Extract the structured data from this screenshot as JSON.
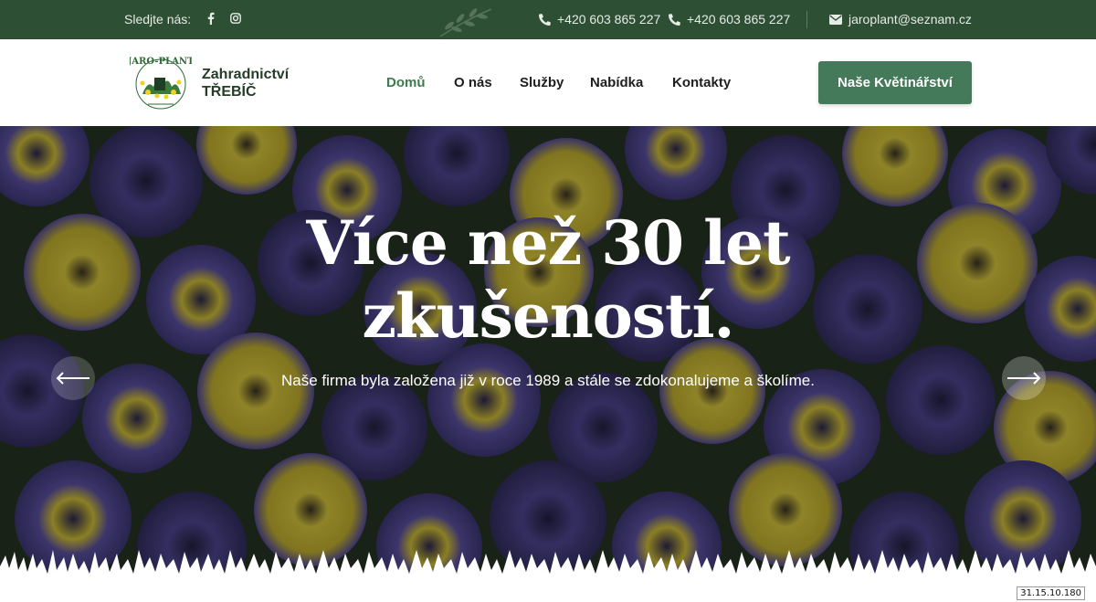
{
  "topbar": {
    "follow_label": "Sledjte nás:",
    "social_icons": [
      "facebook-icon",
      "instagram-icon"
    ],
    "phones": [
      "+420 603 865 227",
      "+420 603 865 227"
    ],
    "email": "jaroplant@seznam.cz",
    "background": "#2d4f34"
  },
  "header": {
    "logo_text": "JARO-PLANT",
    "brand_line1": "Zahradnictví",
    "brand_line2": "TŘEBÍČ",
    "nav": [
      {
        "label": "Domů",
        "active": true
      },
      {
        "label": "O nás",
        "active": false
      },
      {
        "label": "Služby",
        "active": false
      },
      {
        "label": "Nabídka",
        "active": false
      },
      {
        "label": "Kontakty",
        "active": false
      }
    ],
    "cta_label": "Naše Květinářství",
    "accent": "#44795a"
  },
  "hero": {
    "headline_line1": "Více než 30 let",
    "headline_line2": "zkušeností.",
    "subline": "Naše firma byla založena již v roce 1989 a stále se zdokonalujeme a školíme.",
    "prev_icon": "arrow-left-icon",
    "next_icon": "arrow-right-icon"
  },
  "ip_badge": "31.15.10.180"
}
